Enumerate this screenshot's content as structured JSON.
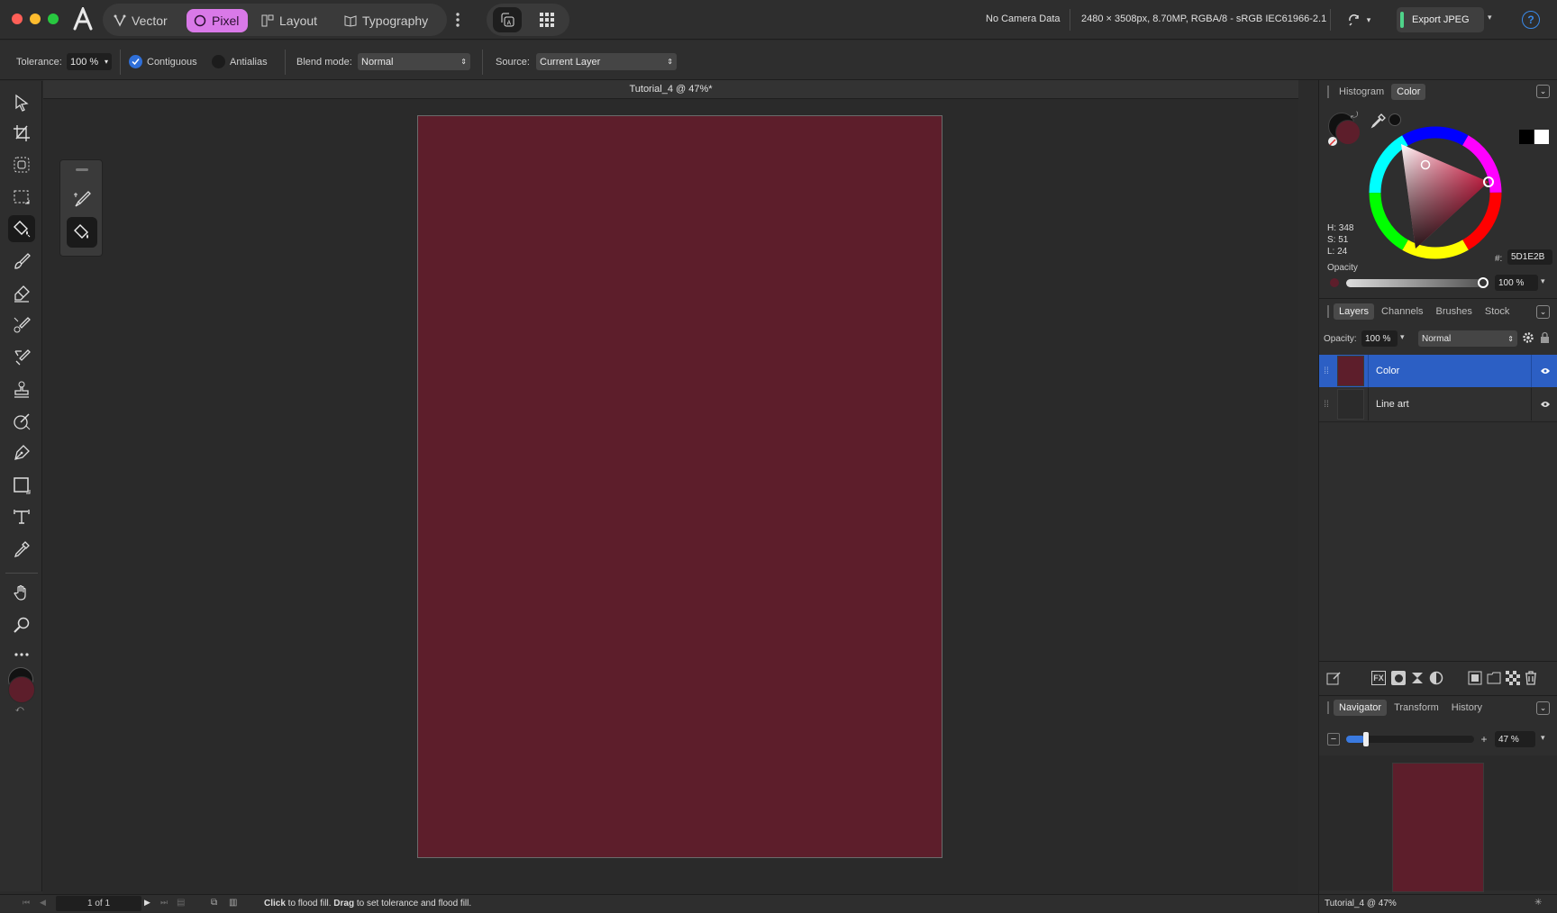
{
  "personas": [
    {
      "label": "Vector"
    },
    {
      "label": "Pixel"
    },
    {
      "label": "Layout"
    },
    {
      "label": "Typography"
    }
  ],
  "topbar": {
    "camera": "No Camera Data",
    "doc_info": "2480 × 3508px, 8.70MP, RGBA/8 - sRGB IEC61966-2.1",
    "export_label": "Export JPEG",
    "help": "?"
  },
  "context": {
    "tolerance_label": "Tolerance:",
    "tolerance_value": "100 %",
    "contiguous_label": "Contiguous",
    "contiguous_checked": true,
    "antialias_label": "Antialias",
    "antialias_checked": false,
    "blend_label": "Blend mode:",
    "blend_value": "Normal",
    "source_label": "Source:",
    "source_value": "Current Layer"
  },
  "document": {
    "tab_title": "Tutorial_4 @ 47%*",
    "fill_color": "#5D1E2B"
  },
  "color_panel": {
    "tabs": [
      "Histogram",
      "Color"
    ],
    "active_tab": 1,
    "h": "H: 348",
    "s": "S: 51",
    "l": "L: 24",
    "hex_label": "#:",
    "hex_value": "5D1E2B",
    "opacity_label": "Opacity",
    "opacity_value": "100 %"
  },
  "layers_panel": {
    "tabs": [
      "Layers",
      "Channels",
      "Brushes",
      "Stock"
    ],
    "active_tab": 0,
    "opacity_label": "Opacity:",
    "opacity_value": "100 %",
    "blend_value": "Normal",
    "layers": [
      {
        "name": "Color",
        "selected": true
      },
      {
        "name": "Line art",
        "selected": false
      }
    ]
  },
  "navigator_panel": {
    "tabs": [
      "Navigator",
      "Transform",
      "History"
    ],
    "active_tab": 0,
    "zoom_value": "47 %",
    "zoom_fraction": 0.08
  },
  "status": {
    "page": "1 of 1",
    "hint_click": "Click",
    "hint_click_text": " to flood fill. ",
    "hint_drag": "Drag",
    "hint_drag_text": " to set tolerance and flood fill.",
    "doc_name": "Tutorial_4 @ 47%"
  },
  "colors": {
    "accent": "#2f6fd8",
    "persona_active": "#d979e8",
    "primary": "#5D1E2B",
    "export_indicator": "#4fd38a"
  }
}
